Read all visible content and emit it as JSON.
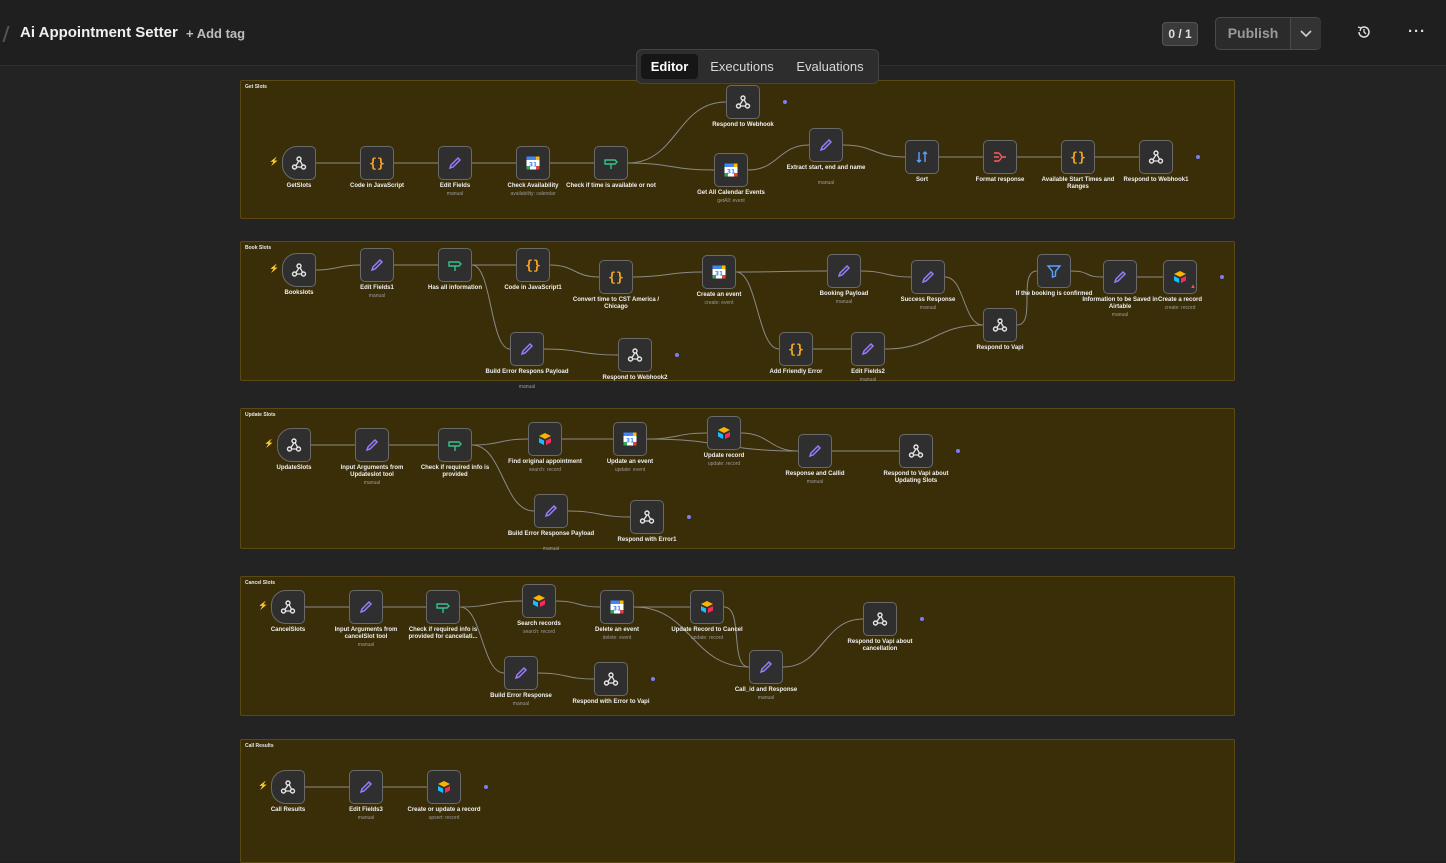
{
  "app": {
    "workflow_title": "Ai Appointment Setter",
    "add_tag": "+ Add tag",
    "version_counter": "0 / 1",
    "publish_label": "Publish"
  },
  "tabs": {
    "editor": "Editor",
    "executions": "Executions",
    "evaluations": "Evaluations"
  },
  "groups": [
    {
      "label": "Get Slots"
    },
    {
      "label": "Book Slots"
    },
    {
      "label": "Update Slots"
    },
    {
      "label": "Cancel Slots"
    },
    {
      "label": "Call Results"
    }
  ],
  "nodes": [
    {
      "name": "GetSlots",
      "sub": "",
      "icon": "webhook",
      "trigger": true
    },
    {
      "name": "Code in JavaScript",
      "sub": "",
      "icon": "code"
    },
    {
      "name": "Edit Fields",
      "sub": "manual",
      "icon": "pen"
    },
    {
      "name": "Check Availability",
      "sub": "availability: calendar",
      "icon": "gcal"
    },
    {
      "name": "Check if time is available or not",
      "sub": "",
      "icon": "if"
    },
    {
      "name": "Respond to Webhook",
      "sub": "",
      "icon": "webhook"
    },
    {
      "name": "Get All Calendar Events",
      "sub": "getAll: event",
      "icon": "gcal"
    },
    {
      "name": "Extract start, end and name",
      "sub": "manual",
      "icon": "pen"
    },
    {
      "name": "Sort",
      "sub": "",
      "icon": "sort"
    },
    {
      "name": "Format response",
      "sub": "",
      "icon": "aggregate"
    },
    {
      "name": "Available Start Times and Ranges",
      "sub": "",
      "icon": "code"
    },
    {
      "name": "Respond to Webhook1",
      "sub": "",
      "icon": "webhook"
    },
    {
      "name": "Bookslots",
      "sub": "",
      "icon": "webhook",
      "trigger": true
    },
    {
      "name": "Edit Fields1",
      "sub": "manual",
      "icon": "pen"
    },
    {
      "name": "Has all information",
      "sub": "",
      "icon": "if"
    },
    {
      "name": "Code in JavaScript1",
      "sub": "",
      "icon": "code"
    },
    {
      "name": "Convert time to CST America / Chicago",
      "sub": "",
      "icon": "code"
    },
    {
      "name": "Create an event",
      "sub": "create: event",
      "icon": "gcal"
    },
    {
      "name": "Booking Payload",
      "sub": "manual",
      "icon": "pen"
    },
    {
      "name": "Success Response",
      "sub": "manual",
      "icon": "pen"
    },
    {
      "name": "Respond to Vapi",
      "sub": "",
      "icon": "webhook"
    },
    {
      "name": "If the booking is confirmed",
      "sub": "",
      "icon": "filter"
    },
    {
      "name": "Information to be Saved in Airtable",
      "sub": "manual",
      "icon": "pen"
    },
    {
      "name": "Create a record",
      "sub": "create: record",
      "icon": "airtable"
    },
    {
      "name": "Build Error Respons Payload",
      "sub": "manual",
      "icon": "pen"
    },
    {
      "name": "Respond to Webhook2",
      "sub": "",
      "icon": "webhook"
    },
    {
      "name": "Add Friendly Error",
      "sub": "",
      "icon": "code"
    },
    {
      "name": "Edit Fields2",
      "sub": "manual",
      "icon": "pen"
    },
    {
      "name": "UpdateSlots",
      "sub": "",
      "icon": "webhook",
      "trigger": true
    },
    {
      "name": "Input Arguments from Updateslot tool",
      "sub": "manual",
      "icon": "pen"
    },
    {
      "name": "Check if required info is provided",
      "sub": "",
      "icon": "if"
    },
    {
      "name": "Find original appointment",
      "sub": "search: record",
      "icon": "airtable"
    },
    {
      "name": "Update an event",
      "sub": "update: event",
      "icon": "gcal"
    },
    {
      "name": "Update record",
      "sub": "update: record",
      "icon": "airtable"
    },
    {
      "name": "Response and Callid",
      "sub": "manual",
      "icon": "pen"
    },
    {
      "name": "Respond to Vapi about Updating Slots",
      "sub": "",
      "icon": "webhook"
    },
    {
      "name": "Build Error Response Payload",
      "sub": "manual",
      "icon": "pen"
    },
    {
      "name": "Respond with Error1",
      "sub": "",
      "icon": "webhook"
    },
    {
      "name": "CancelSlots",
      "sub": "",
      "icon": "webhook",
      "trigger": true
    },
    {
      "name": "Input Arguments from cancelSlot tool",
      "sub": "manual",
      "icon": "pen"
    },
    {
      "name": "Check if required info is provided for cancellati...",
      "sub": "",
      "icon": "if"
    },
    {
      "name": "Search records",
      "sub": "search: record",
      "icon": "airtable"
    },
    {
      "name": "Delete an event",
      "sub": "delete: event",
      "icon": "gcal"
    },
    {
      "name": "Update Record to Cancel",
      "sub": "update: record",
      "icon": "airtable"
    },
    {
      "name": "Call_id and Response",
      "sub": "manual",
      "icon": "pen"
    },
    {
      "name": "Respond to Vapi about cancellation",
      "sub": "",
      "icon": "webhook"
    },
    {
      "name": "Build Error Response",
      "sub": "manual",
      "icon": "pen"
    },
    {
      "name": "Respond with Error to Vapi",
      "sub": "",
      "icon": "webhook"
    },
    {
      "name": "Call Results",
      "sub": "",
      "icon": "webhook",
      "trigger": true
    },
    {
      "name": "Edit Fields3",
      "sub": "manual",
      "icon": "pen"
    },
    {
      "name": "Create or update a record",
      "sub": "upsert: record",
      "icon": "airtable"
    }
  ],
  "colors": {
    "group_fill": "#3a2e08",
    "group_border": "#5c4a14",
    "edge": "#8a8a8a",
    "code_icon": "#f5a623",
    "pen_icon": "#9b7bff",
    "if_icon": "#35c28a",
    "trigger_bolt": "#ff6b3d"
  }
}
